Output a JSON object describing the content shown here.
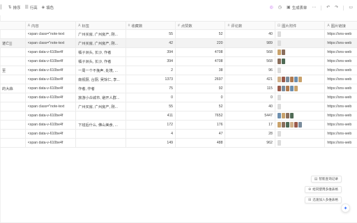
{
  "toolbar": {
    "left": [
      {
        "icon": "sort-icon",
        "label": "排序"
      },
      {
        "icon": "row-height-icon",
        "label": "行高"
      },
      {
        "icon": "fill-color-icon",
        "label": "填色"
      }
    ],
    "generate_form_label": "生成表单"
  },
  "columns": [
    {
      "type": "",
      "label": ""
    },
    {
      "type": "A",
      "label": "内容"
    },
    {
      "type": "A",
      "label": "标签"
    },
    {
      "type": "#",
      "label": "收藏数"
    },
    {
      "type": "#",
      "label": "点赞数"
    },
    {
      "type": "#",
      "label": "评论数"
    },
    {
      "type": "📎",
      "label": "图片附件"
    },
    {
      "type": "A",
      "label": "图片链接"
    }
  ],
  "rows": [
    {
      "title": "",
      "content": "<span class=\"note-text",
      "tags": "广州买房, 广州房产, 刚...",
      "fav": "55",
      "likes": "52",
      "comments": "40",
      "thumbs": 1,
      "link": "https://sns-web"
    },
    {
      "title": "道亡▒",
      "content": "<span class=\"note-text",
      "tags": "广州买房, 广州房产, 刚...",
      "fav": "42",
      "likes": "220",
      "comments": "989",
      "thumbs": 1,
      "link": "https://sns-web"
    },
    {
      "title": "",
      "content": "<span data-v-610be4f",
      "tags": "橘子洲头, 长沙, 作者",
      "fav": "394",
      "likes": "4708",
      "comments": "568",
      "thumbs": 2,
      "link": "https://sns-web"
    },
    {
      "title": "",
      "content": "<span data-v-610be4f",
      "tags": "橘子洲头, 长沙, 作者",
      "fav": "394",
      "likes": "4708",
      "comments": "568",
      "thumbs": 2,
      "link": "https://sns-web"
    },
    {
      "title": "至",
      "content": "<span data-v-610be4f",
      "tags": "一周一个不挽声, 处境, ...",
      "fav": "2",
      "likes": "38",
      "comments": "96",
      "thumbs": 1,
      "link": "https://sns-web"
    },
    {
      "title": "",
      "content": "<span data-v-610be4f",
      "tags": "南视厨, 台厨, 吴馀仁, 李...",
      "fav": "1373",
      "likes": "2697",
      "comments": "421",
      "thumbs": 6,
      "link": "https://sns-web"
    },
    {
      "title": "的大蒜",
      "content": "<span data-v-610be4f",
      "tags": "作者, 作者",
      "fav": "75",
      "likes": "92",
      "comments": "115",
      "thumbs": 5,
      "link": "https://sns-web"
    },
    {
      "title": "",
      "content": "<span data-v-610be4f",
      "tags": "旅游小众城市, 避开人群...",
      "fav": "0",
      "likes": "0",
      "comments": "0",
      "thumbs": 1,
      "link": "https://sns-web"
    },
    {
      "title": "",
      "content": "<span class=\"note-text",
      "tags": "广州买房, 广州房产, 刚...",
      "fav": "55",
      "likes": "52",
      "comments": "40",
      "thumbs": 1,
      "link": "https://sns-web"
    },
    {
      "title": "",
      "content": "<span data-v-610be4f",
      "tags": "",
      "fav": "411",
      "likes": "7652",
      "comments": "5447",
      "thumbs": 4,
      "link": "https://sns-web"
    },
    {
      "title": "",
      "content": "<span data-v-610be4f",
      "tags": "下班后什么, 佛山美食, ...",
      "fav": "172",
      "likes": "176",
      "comments": "17",
      "thumbs": 6,
      "link": "https://sns-web"
    },
    {
      "title": "",
      "content": "<span data-v-610be4f",
      "tags": "",
      "fav": "4",
      "likes": "47",
      "comments": "28",
      "thumbs": 1,
      "link": "https://sns-web"
    },
    {
      "title": "",
      "content": "<span data-v-610be4f",
      "tags": "",
      "fav": "149",
      "likes": "488",
      "comments": "962",
      "thumbs": 1,
      "link": "https://sns-web"
    }
  ],
  "floating": [
    {
      "icon": "record-icon",
      "label": "智能查询记录"
    },
    {
      "icon": "multi-table-icon",
      "label": "给同使用多维表格"
    },
    {
      "icon": "join-icon",
      "label": "迅速加入多维表格"
    }
  ],
  "colors": {
    "accent": "#2f6bff",
    "row_highlight": "#f3f3f3",
    "border": "#ececec"
  }
}
